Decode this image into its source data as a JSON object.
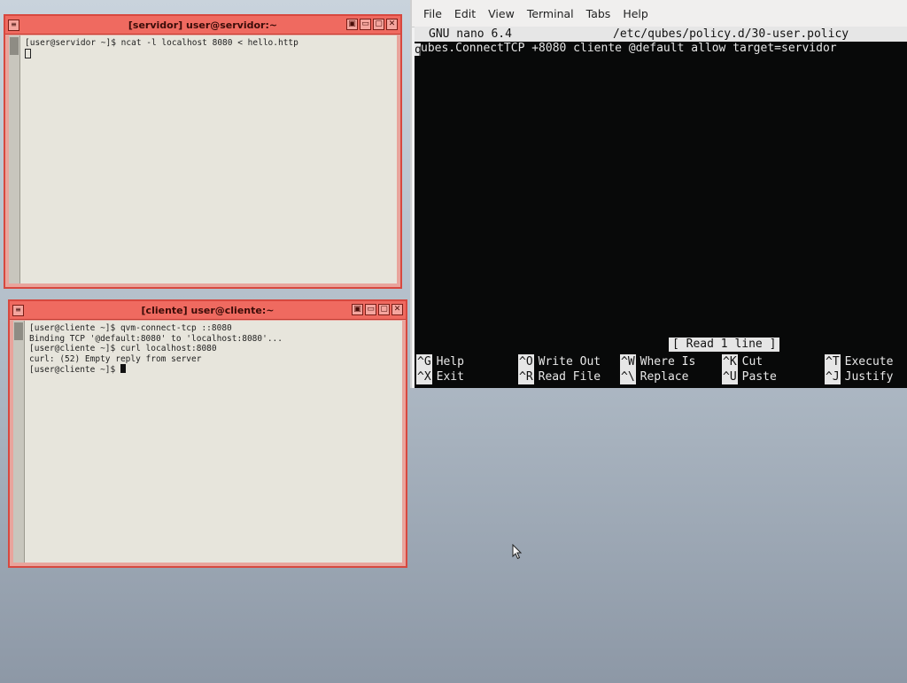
{
  "servidor_window": {
    "title": "[servidor] user@servidor:~",
    "menu_glyph": "≡",
    "controls": [
      "▣",
      "▭",
      "▢",
      "✕"
    ],
    "lines": [
      "[user@servidor ~]$ ncat -l localhost 8080 < hello.http"
    ]
  },
  "cliente_window": {
    "title": "[cliente] user@cliente:~",
    "menu_glyph": "≡",
    "controls": [
      "▣",
      "▭",
      "▢",
      "✕"
    ],
    "lines": [
      "[user@cliente ~]$ qvm-connect-tcp ::8080",
      "Binding TCP '@default:8080' to 'localhost:8080'...",
      "[user@cliente ~]$ curl localhost:8080",
      "curl: (52) Empty reply from server",
      "[user@cliente ~]$ "
    ]
  },
  "nano_terminal": {
    "menubar": [
      "File",
      "Edit",
      "View",
      "Terminal",
      "Tabs",
      "Help"
    ],
    "version": "GNU nano 6.4",
    "filename": "/etc/qubes/policy.d/30-user.policy",
    "content_first_char": "q",
    "content_rest": "ubes.ConnectTCP +8080 cliente @default allow target=servidor",
    "status": "[ Read 1 line ]",
    "shortcuts": [
      {
        "key": "^G",
        "label": "Help"
      },
      {
        "key": "^X",
        "label": "Exit"
      },
      {
        "key": "^O",
        "label": "Write Out"
      },
      {
        "key": "^R",
        "label": "Read File"
      },
      {
        "key": "^W",
        "label": "Where Is"
      },
      {
        "key": "^\\",
        "label": "Replace"
      },
      {
        "key": "^K",
        "label": "Cut"
      },
      {
        "key": "^U",
        "label": "Paste"
      },
      {
        "key": "^T",
        "label": "Execute"
      },
      {
        "key": "^J",
        "label": "Justify"
      }
    ]
  },
  "colors": {
    "qube_red_border": "#d7483f",
    "qube_red_title": "#ef6a60",
    "terminal_bg": "#080909"
  }
}
